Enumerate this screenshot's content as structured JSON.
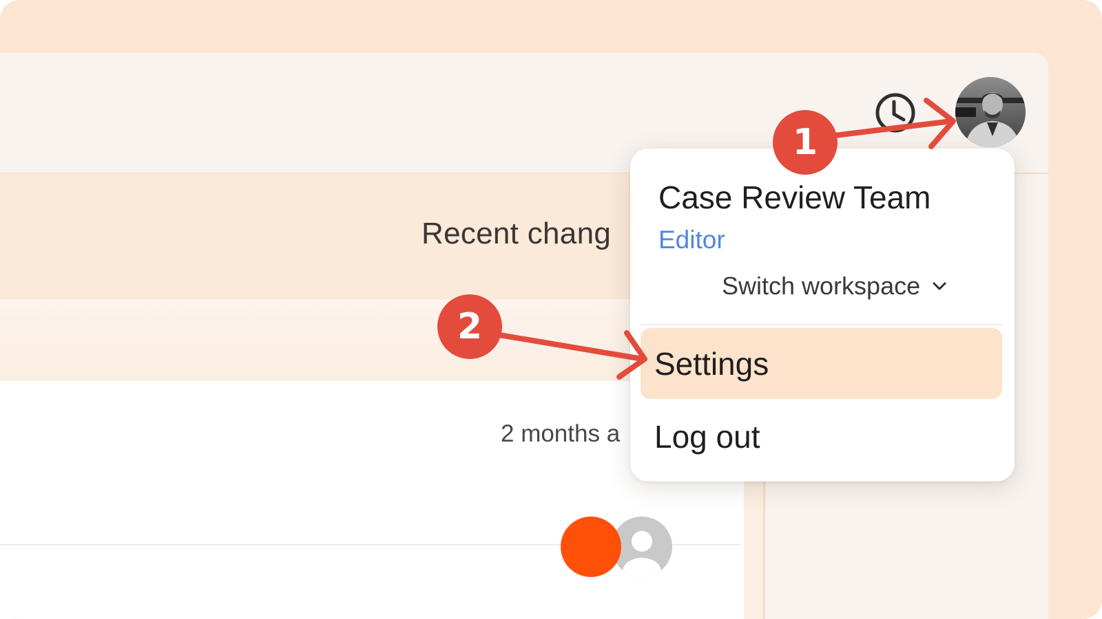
{
  "main": {
    "section_title": "Recent chang",
    "row_timestamp": "2 months a"
  },
  "header": {
    "history_icon": "clock-history-icon",
    "avatar_icon": "user-photo-avatar"
  },
  "dropdown": {
    "team_name": "Case Review Team",
    "role": "Editor",
    "switch_label": "Switch workspace",
    "items": [
      {
        "label": "Settings",
        "highlighted": true
      },
      {
        "label": "Log out",
        "highlighted": false
      }
    ]
  },
  "annotations": {
    "step_1": "1",
    "step_2": "2"
  },
  "colors": {
    "accent_orange": "#ff5009",
    "annotation_red": "#e34b3c",
    "role_blue": "#4f86e3",
    "highlight_peach": "#fde3cc",
    "frame_peach": "#fde5d1"
  }
}
